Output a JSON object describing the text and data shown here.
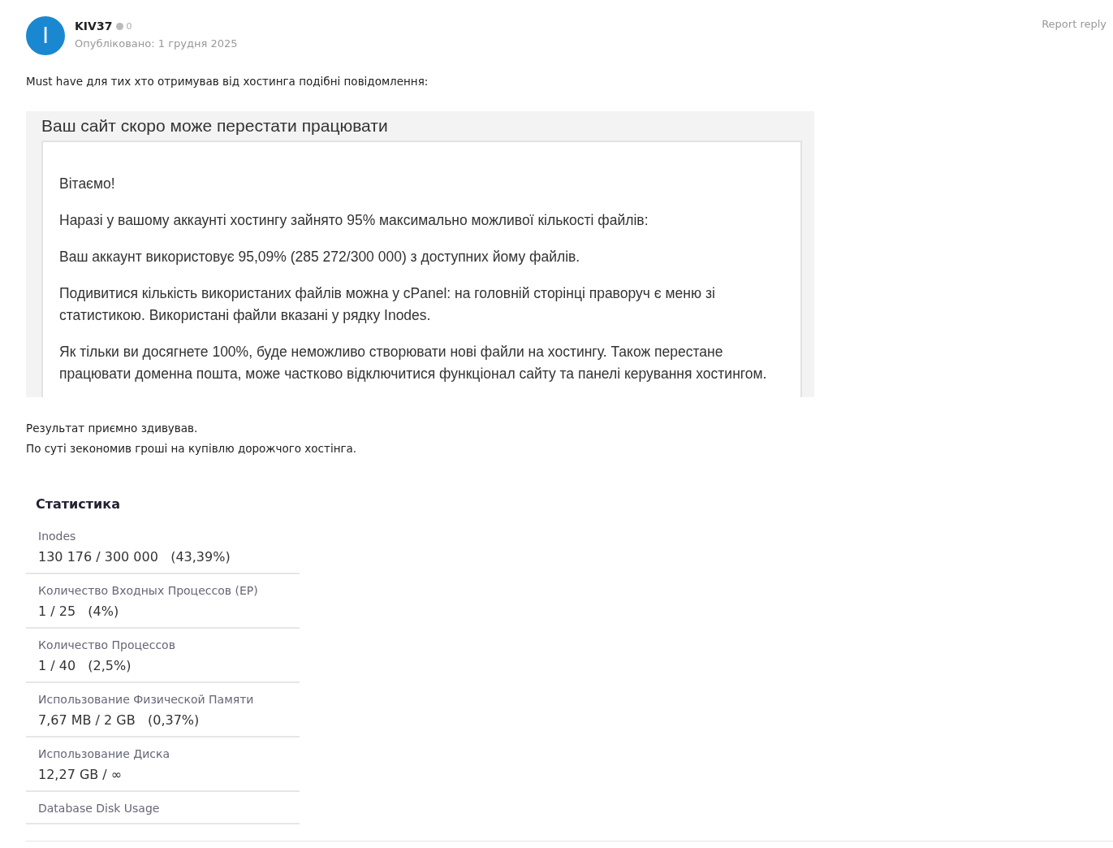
{
  "post": {
    "author": {
      "initial": "I",
      "name": "KIV37",
      "reputation": "0"
    },
    "published": "Опубліковано: 1 грудня 2025",
    "report_link": "Report reply",
    "intro": "Must have для тих хто отримував від хостинга подібні повідомлення:",
    "email_screenshot": {
      "subject": "Ваш сайт скоро може перестати працювати",
      "paragraphs": [
        "Вітаємо!",
        "Наразі у вашому аккаунті хостингу зайнято 95% максимально можливої кількості файлів:",
        "Ваш аккаунт використовує 95,09% (285 272/300 000) з доступних йому файлів.",
        "Подивитися кількість використаних файлів можна у cPanel: на головній сторінці праворуч є меню зі статистикою. Використані файли вказані у рядку Inodes.",
        "Як тільки ви досягнете 100%, буде неможливо створювати нові файли на хостингу. Також перестане працювати доменна пошта, може частково відключитися функціонал сайту та панелі керування хостингом."
      ]
    },
    "result_lines": [
      "Результат приємно здивував.",
      "По суті зекономив гроші на купівлю дорожчого хостінга."
    ],
    "stats_screenshot": {
      "title": "Статистика",
      "rows": [
        {
          "label": "Inodes",
          "value": "130 176 / 300 000",
          "percent": "(43,39%)"
        },
        {
          "label": "Количество Входных Процессов (EP)",
          "value": "1 / 25",
          "percent": "(4%)"
        },
        {
          "label": "Количество Процессов",
          "value": "1 / 40",
          "percent": "(2,5%)"
        },
        {
          "label": "Использование Физической Памяти",
          "value": "7,67 MB / 2 GB",
          "percent": "(0,37%)"
        },
        {
          "label": "Использование Диска",
          "value": "12,27 GB / ∞"
        },
        {
          "label": "Database Disk Usage"
        }
      ]
    }
  }
}
